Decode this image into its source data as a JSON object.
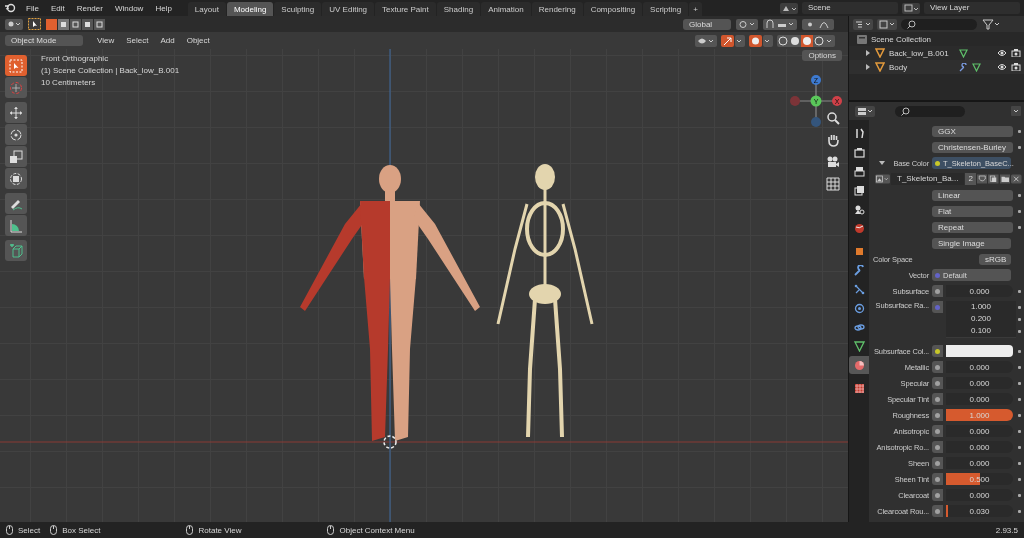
{
  "top_bar": {
    "menus": [
      "File",
      "Edit",
      "Render",
      "Window",
      "Help"
    ],
    "workspaces": [
      {
        "label": "Layout",
        "selected": false
      },
      {
        "label": "Modeling",
        "selected": true
      },
      {
        "label": "Sculpting",
        "selected": false
      },
      {
        "label": "UV Editing",
        "selected": false
      },
      {
        "label": "Texture Paint",
        "selected": false
      },
      {
        "label": "Shading",
        "selected": false
      },
      {
        "label": "Animation",
        "selected": false
      },
      {
        "label": "Rendering",
        "selected": false
      },
      {
        "label": "Compositing",
        "selected": false
      },
      {
        "label": "Scripting",
        "selected": false
      }
    ],
    "add_tab": "+",
    "scene": "Scene",
    "view_layer": "View Layer"
  },
  "tool_header": {
    "orientation": "Global",
    "options": "Options"
  },
  "viewport_header": {
    "mode": "Object Mode",
    "menus": [
      "View",
      "Select",
      "Add",
      "Object"
    ]
  },
  "toolbar": [
    {
      "kind": "select",
      "selected": true
    },
    {
      "kind": "cursor",
      "selected": false
    },
    {
      "kind": "move",
      "selected": false
    },
    {
      "kind": "rotate",
      "selected": false
    },
    {
      "kind": "scale",
      "selected": false
    },
    {
      "kind": "transform",
      "selected": false
    },
    {
      "kind": "annotate",
      "selected": false
    },
    {
      "kind": "measure",
      "selected": false
    },
    {
      "kind": "add-cube",
      "selected": false
    }
  ],
  "viewport": {
    "info": [
      "Front Orthographic",
      "(1) Scene Collection | Back_low_B.001",
      "10 Centimeters"
    ],
    "gizmo": [
      "Z",
      "Y",
      "X"
    ]
  },
  "outliner": {
    "root": "Scene Collection",
    "items": [
      {
        "name": "Back_low_B.001",
        "expanded": false,
        "modifier": false
      },
      {
        "name": "Body",
        "expanded": false,
        "modifier": true
      }
    ]
  },
  "properties": {
    "tabs": [
      {
        "kind": "tool",
        "selected": false
      },
      {
        "kind": "render",
        "selected": false
      },
      {
        "kind": "output",
        "selected": false
      },
      {
        "kind": "view-layer",
        "selected": false
      },
      {
        "kind": "scene",
        "selected": false
      },
      {
        "kind": "world",
        "selected": false
      },
      {
        "kind": "object",
        "selected": false
      },
      {
        "kind": "modifier",
        "selected": false
      },
      {
        "kind": "particles",
        "selected": false
      },
      {
        "kind": "physics",
        "selected": false
      },
      {
        "kind": "constraints",
        "selected": false
      },
      {
        "kind": "data",
        "selected": false
      },
      {
        "kind": "material",
        "selected": true
      },
      {
        "kind": "texture",
        "selected": false
      }
    ],
    "rows": [
      {
        "kind": "dropdown",
        "value": "GGX",
        "animatable": true
      },
      {
        "kind": "dropdown",
        "value": "Christensen-Burley",
        "animatable": true
      },
      {
        "kind": "link",
        "label": "Base Color",
        "value": "T_Skeleton_BaseC...",
        "expanded": true,
        "color": "#c7c729"
      },
      {
        "kind": "image",
        "value": "T_Skeleton_Ba...",
        "users": "2"
      },
      {
        "kind": "dropdown",
        "value": "Linear",
        "animatable": true
      },
      {
        "kind": "dropdown",
        "value": "Flat",
        "animatable": true
      },
      {
        "kind": "dropdown",
        "value": "Repeat",
        "animatable": true
      },
      {
        "kind": "dropdown",
        "value": "Single Image",
        "animatable": false
      },
      {
        "kind": "setting",
        "label": "Color Space",
        "value": "sRGB"
      },
      {
        "kind": "link",
        "label": "Vector",
        "value": "Default",
        "expanded": false,
        "color": "#6363c7"
      },
      {
        "kind": "value",
        "label": "Subsurface",
        "value": "0.000",
        "color": "#a1a1a1"
      },
      {
        "kind": "vector",
        "label": "Subsurface Ra...",
        "values": [
          "1.000",
          "0.200",
          "0.100"
        ],
        "color": "#6363c7"
      },
      {
        "kind": "swatch",
        "label": "Subsurface Col...",
        "swatch": {
          "color": "#eeeeee"
        },
        "color": "#c7c729"
      },
      {
        "kind": "value",
        "label": "Metallic",
        "value": "0.000",
        "color": "#a1a1a1"
      },
      {
        "kind": "value",
        "label": "Specular",
        "value": "0.000",
        "color": "#a1a1a1"
      },
      {
        "kind": "value",
        "label": "Specular Tint",
        "value": "0.000",
        "color": "#a1a1a1"
      },
      {
        "kind": "value",
        "label": "Roughness",
        "value": "1.000",
        "level": 1,
        "color": "#a1a1a1"
      },
      {
        "kind": "value",
        "label": "Anisotropic",
        "value": "0.000",
        "color": "#a1a1a1"
      },
      {
        "kind": "value",
        "label": "Anisotropic Ro...",
        "value": "0.000",
        "color": "#a1a1a1"
      },
      {
        "kind": "value",
        "label": "Sheen",
        "value": "0.000",
        "color": "#a1a1a1"
      },
      {
        "kind": "value",
        "label": "Sheen Tint",
        "value": "0.500",
        "level": 0.5,
        "color": "#a1a1a1"
      },
      {
        "kind": "value",
        "label": "Clearcoat",
        "value": "0.000",
        "color": "#a1a1a1"
      },
      {
        "kind": "value",
        "label": "Clearcoat Rou...",
        "value": "0.030",
        "level": 0.03,
        "color": "#a1a1a1"
      }
    ]
  },
  "status_bar": {
    "hints": [
      "Select",
      "Box Select",
      "Rotate View",
      "Object Context Menu"
    ],
    "version": "2.93.5"
  }
}
